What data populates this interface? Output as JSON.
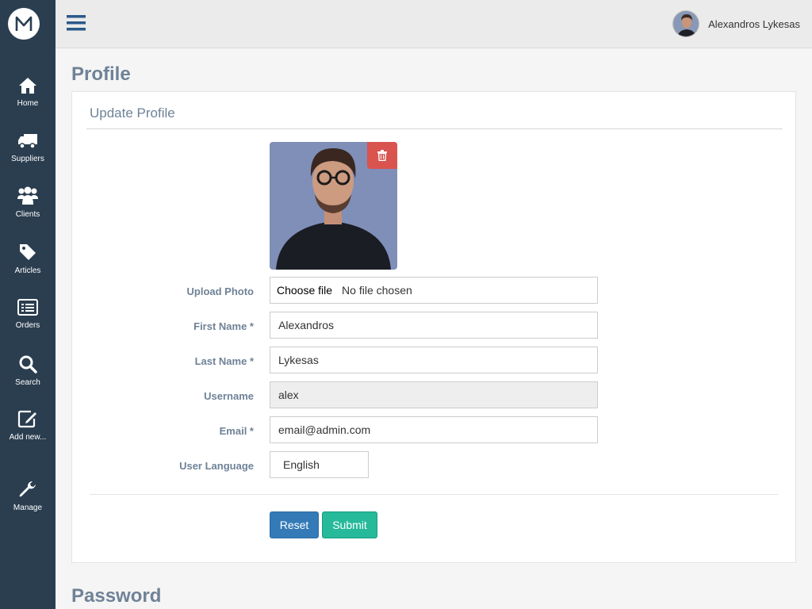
{
  "sidebar": {
    "logo_letter": "M",
    "items": [
      {
        "label": "Home",
        "icon": "home-icon"
      },
      {
        "label": "Suppliers",
        "icon": "truck-icon"
      },
      {
        "label": "Clients",
        "icon": "users-icon"
      },
      {
        "label": "Articles",
        "icon": "tag-icon"
      },
      {
        "label": "Orders",
        "icon": "list-icon"
      },
      {
        "label": "Search",
        "icon": "search-icon"
      },
      {
        "label": "Add new...",
        "icon": "edit-icon"
      },
      {
        "label": "Manage",
        "icon": "wrench-icon"
      }
    ]
  },
  "topbar": {
    "user_name": "Alexandros Lykesas"
  },
  "page": {
    "title": "Profile",
    "password_title": "Password"
  },
  "profile_panel": {
    "title": "Update Profile",
    "labels": {
      "upload_photo": "Upload Photo",
      "first_name": "First Name *",
      "last_name": "Last Name *",
      "username": "Username",
      "email": "Email *",
      "user_language": "User Language"
    },
    "values": {
      "file_button": "Choose file",
      "file_status": "No file chosen",
      "first_name": "Alexandros",
      "last_name": "Lykesas",
      "username": "alex",
      "email": "email@admin.com",
      "user_language": "English"
    },
    "buttons": {
      "reset": "Reset",
      "submit": "Submit"
    }
  },
  "colors": {
    "sidebar_bg": "#2b3e50",
    "heading": "#6f8297",
    "reset_button": "#337ab7",
    "submit_button": "#26b99a",
    "delete_button": "#d9534f"
  }
}
